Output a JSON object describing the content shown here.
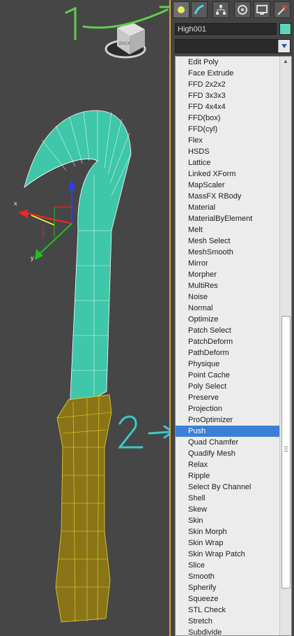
{
  "object_name": "High001",
  "swatch_color": "#5ed6b8",
  "command_tabs": [
    {
      "icon": "create-icon",
      "active": true
    },
    {
      "icon": "modify-icon",
      "active": false
    },
    {
      "icon": "hierarchy-icon",
      "active": false
    },
    {
      "icon": "motion-icon",
      "active": false
    },
    {
      "icon": "display-icon",
      "active": false
    },
    {
      "icon": "utilities-icon",
      "active": false
    }
  ],
  "viewcube": {
    "face_label": "BACK"
  },
  "gizmo": {
    "x_label": "x",
    "y_label": "y"
  },
  "annotations": {
    "step1": "1",
    "step2": "2."
  },
  "modifier_list": {
    "selected": "Push",
    "items": [
      "Edit Poly",
      "Face Extrude",
      "FFD 2x2x2",
      "FFD 3x3x3",
      "FFD 4x4x4",
      "FFD(box)",
      "FFD(cyl)",
      "Flex",
      "HSDS",
      "Lattice",
      "Linked XForm",
      "MapScaler",
      "MassFX RBody",
      "Material",
      "MaterialByElement",
      "Melt",
      "Mesh Select",
      "MeshSmooth",
      "Mirror",
      "Morpher",
      "MultiRes",
      "Noise",
      "Normal",
      "Optimize",
      "Patch Select",
      "PatchDeform",
      "PathDeform",
      "Physique",
      "Point Cache",
      "Poly Select",
      "Preserve",
      "Projection",
      "ProOptimizer",
      "Push",
      "Quad Chamfer",
      "Quadify Mesh",
      "Relax",
      "Ripple",
      "Select By Channel",
      "Shell",
      "Skew",
      "Skin",
      "Skin Morph",
      "Skin Wrap",
      "Skin Wrap Patch",
      "Slice",
      "Smooth",
      "Spherify",
      "Squeeze",
      "STL Check",
      "Stretch",
      "Subdivide"
    ]
  }
}
